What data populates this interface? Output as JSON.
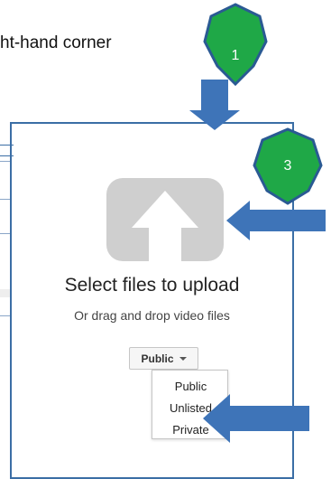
{
  "instruction": {
    "text": "ht-hand corner"
  },
  "upload": {
    "title": "Select files to upload",
    "subtitle": "Or drag and drop video files",
    "icon": "upload-arrow-icon"
  },
  "privacy": {
    "selected": "Public",
    "options": [
      "Public",
      "Unlisted",
      "Private"
    ]
  },
  "callouts": [
    {
      "label": "1"
    },
    {
      "label": "3"
    }
  ],
  "colors": {
    "badge": "#1fa847",
    "badge_border": "#2a5a93",
    "arrow": "#3e74b8",
    "panel_border": "#3b6ea5"
  }
}
